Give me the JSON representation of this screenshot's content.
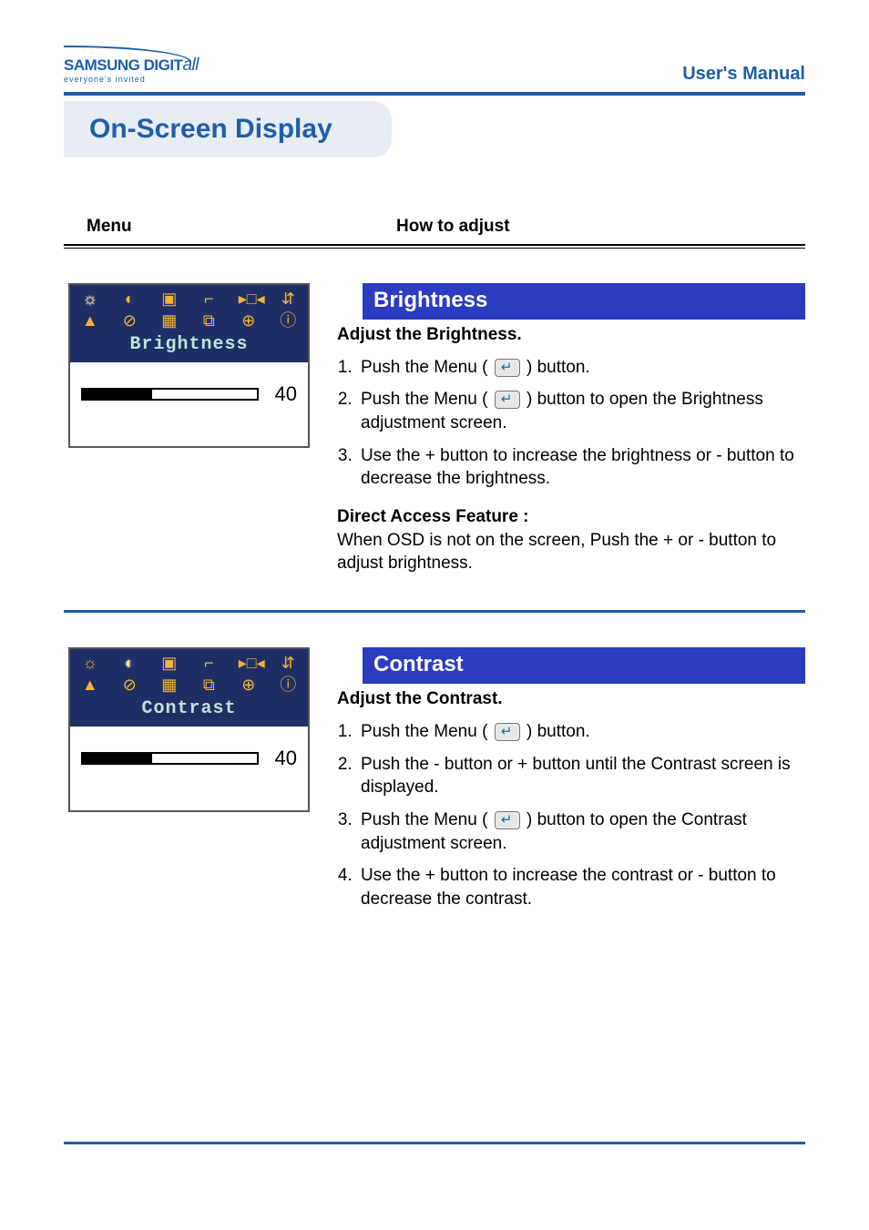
{
  "header": {
    "logo_main_a": "SAMSUNG DIGIT",
    "logo_main_b": "all",
    "logo_sub": "everyone's invited",
    "manual": "User's Manual"
  },
  "section_title": "On-Screen Display",
  "cols": {
    "menu": "Menu",
    "howto": "How to adjust"
  },
  "items": [
    {
      "osd_label": "Brightness",
      "value": "40",
      "fill_pct": 40,
      "selected_icon_index": 0,
      "heading": "Brightness",
      "subheading": "Adjust the Brightness.",
      "steps": [
        "Push the Menu ( [btn] ) button.",
        "Push the Menu ( [btn] ) button to open the Brightness adjustment screen.",
        "Use the + button to increase the brightness or - button to decrease the brightness."
      ],
      "daf_title": "Direct Access Feature :",
      "daf_body": "When OSD is not on the screen, Push the + or - button to adjust brightness."
    },
    {
      "osd_label": "Contrast",
      "value": "40",
      "fill_pct": 40,
      "selected_icon_index": 1,
      "heading": "Contrast",
      "subheading": "Adjust the Contrast.",
      "steps": [
        "Push the Menu ( [btn] ) button.",
        "Push the - button or + button until the Contrast screen is displayed.",
        "Push the Menu ( [btn] ) button to open the Contrast adjustment screen.",
        "Use the + button to increase the contrast or - button to decrease the contrast."
      ],
      "daf_title": "",
      "daf_body": ""
    }
  ],
  "icons_glyphs": [
    "☼",
    "◐",
    "▣",
    "⌐",
    "▸□◂",
    "⇵",
    "▲",
    "⊘",
    "▦",
    "⧉",
    "⊕",
    "ⓘ"
  ]
}
